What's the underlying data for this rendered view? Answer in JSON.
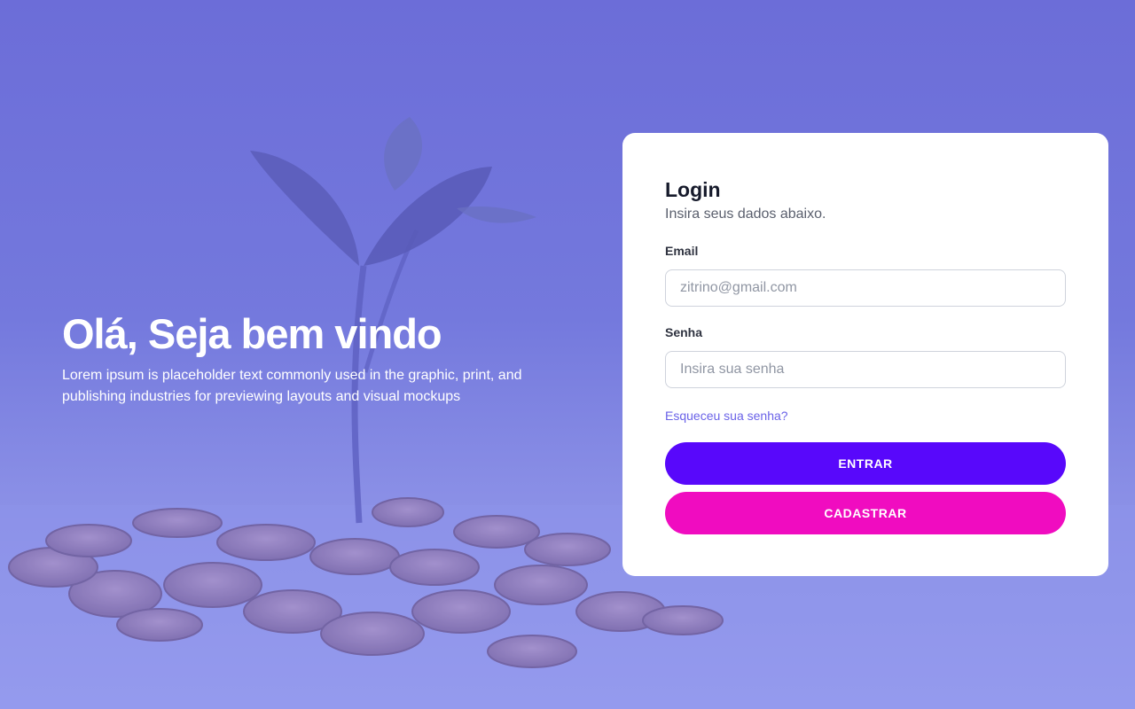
{
  "hero": {
    "title": "Olá, Seja bem vindo",
    "description": "Lorem ipsum is placeholder text commonly used in the graphic, print, and publishing industries for previewing layouts and visual mockups"
  },
  "login": {
    "title": "Login",
    "subtitle": "Insira seus dados abaixo.",
    "email": {
      "label": "Email",
      "placeholder": "zitrino@gmail.com",
      "value": ""
    },
    "password": {
      "label": "Senha",
      "placeholder": "Insira sua senha",
      "value": ""
    },
    "forgot_link": "Esqueceu sua senha?",
    "submit_label": "ENTRAR",
    "register_label": "CADASTRAR"
  },
  "colors": {
    "background": "#6c6dd8",
    "primary_button": "#5808fb",
    "secondary_button": "#f00cc0",
    "link": "#6a62e8"
  },
  "background_image": "plant-growing-from-coins"
}
